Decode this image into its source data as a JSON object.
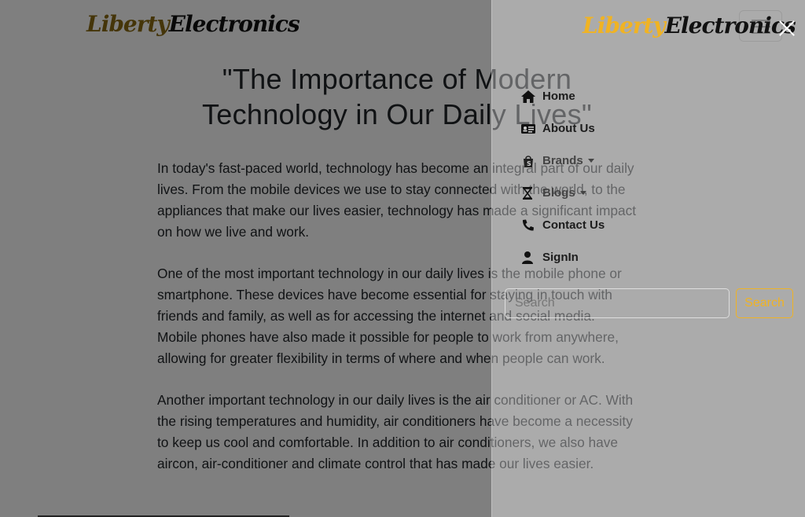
{
  "colors": {
    "brand_liberty": "#8a6a12",
    "brand_electronics": "#111111",
    "accent": "#f0b323"
  },
  "navbar": {
    "logo_part1": "Liberty",
    "logo_part2": "Electronics"
  },
  "article": {
    "title": "\"The Importance of Modern Technology in Our Daily Lives\"",
    "paragraphs": [
      "In today's fast-paced world, technology has become an integral part of our daily lives. From the mobile devices we use to stay connected with the world, to the appliances that make our lives easier, technology has made a significant impact on how we live and work.",
      "One of the most important technology in our daily lives is the mobile phone or smartphone. These devices have become essential for staying in touch with friends and family, as well as for accessing the internet and social media. Mobile phones have also made it possible for people to work from anywhere, allowing for greater flexibility in terms of where and when people can work.",
      "Another important technology in our daily lives is the air conditioner or AC. With the rising temperatures and humidity, air conditioners have become a necessity to keep us cool and comfortable. In addition to air conditioners, we also have aircon, air-conditioner and climate control that has made our lives easier."
    ]
  },
  "offcanvas": {
    "logo_part1": "Liberty",
    "logo_part2": "Electronics",
    "menu": [
      {
        "label": "Home",
        "icon": "home-icon"
      },
      {
        "label": "About Us",
        "icon": "id-card-icon"
      },
      {
        "label": "Brands",
        "icon": "shopping-bag-icon"
      },
      {
        "label": "Blogs",
        "icon": "hourglass-icon"
      },
      {
        "label": "Contact Us",
        "icon": "phone-icon"
      },
      {
        "label": "SignIn",
        "icon": "user-icon"
      }
    ],
    "search": {
      "placeholder": "Search",
      "button_label": "Search"
    }
  }
}
